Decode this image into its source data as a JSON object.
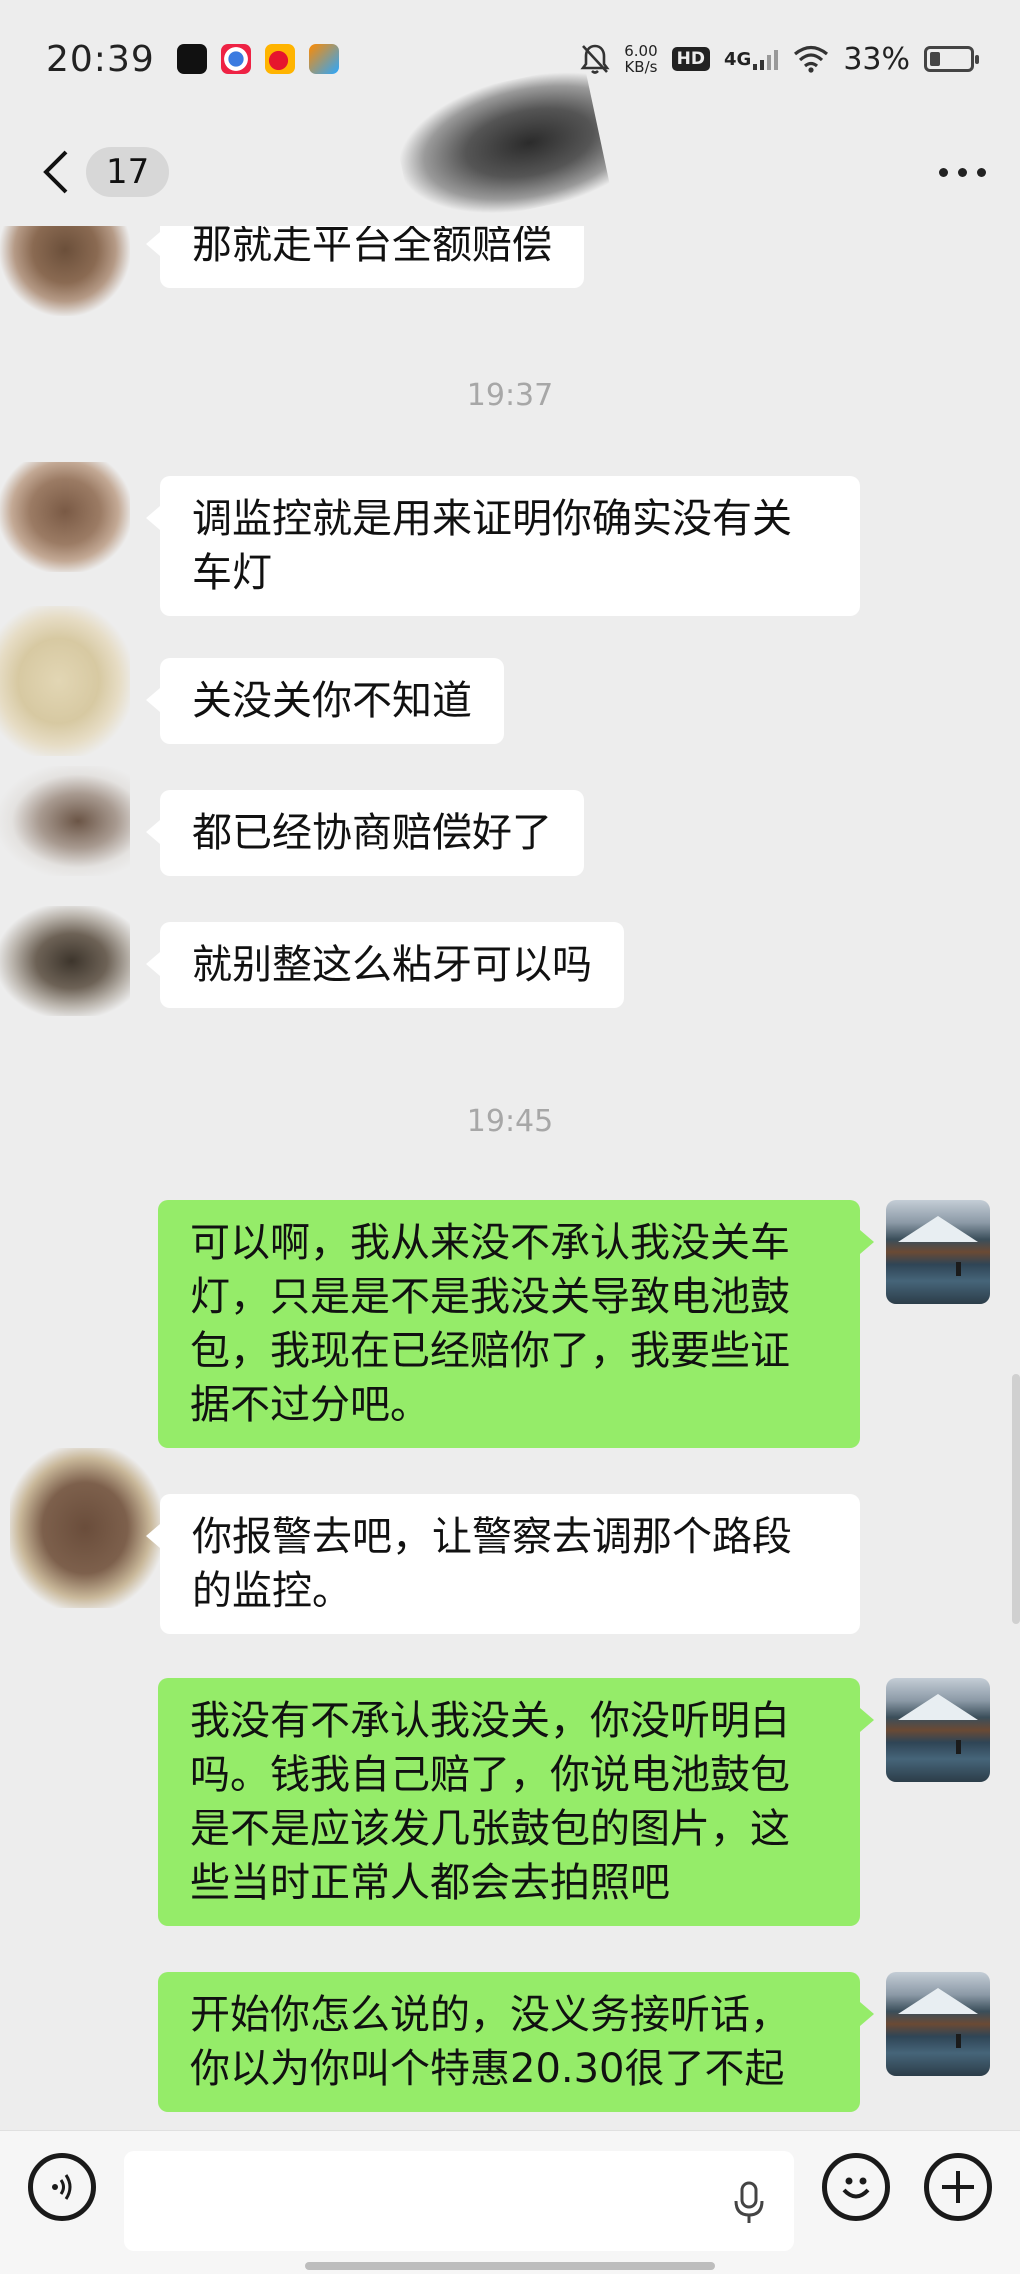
{
  "status_bar": {
    "time": "20:39",
    "speed_value": "6.00",
    "speed_unit": "KB/s",
    "hd_label": "HD",
    "network": "4G",
    "battery": "33%"
  },
  "header": {
    "unread_count": "17"
  },
  "messages": [
    {
      "type": "in",
      "text": "那就走平台全额赔偿"
    },
    {
      "type": "time",
      "text": "19:37"
    },
    {
      "type": "in",
      "lines": [
        "调监控就是用来证明你确实没有关",
        "车灯"
      ]
    },
    {
      "type": "in",
      "text": "关没关你不知道"
    },
    {
      "type": "in",
      "text": "都已经协商赔偿好了"
    },
    {
      "type": "in",
      "text": "就别整这么粘牙可以吗"
    },
    {
      "type": "time",
      "text": "19:45"
    },
    {
      "type": "out",
      "lines": [
        "可以啊，我从来没不承认我没关车",
        "灯，只是是不是我没关导致电池鼓",
        "包，我现在已经赔你了，我要些证",
        "据不过分吧。"
      ]
    },
    {
      "type": "in",
      "lines": [
        "你报警去吧，让警察去调那个路段",
        "的监控。"
      ]
    },
    {
      "type": "out",
      "lines": [
        "我没有不承认我没关，你没听明白",
        "吗。钱我自己赔了，你说电池鼓包",
        "是不是应该发几张鼓包的图片，这",
        "些当时正常人都会去拍照吧"
      ]
    },
    {
      "type": "out",
      "lines": [
        "开始你怎么说的，没义务接听话，",
        "你以为你叫个特惠20.30很了不起"
      ]
    }
  ],
  "colors": {
    "background": "#ededed",
    "incoming_bubble": "#ffffff",
    "outgoing_bubble": "#95ec69"
  },
  "icons": [
    "back-arrow",
    "more-dots",
    "voice-toggle",
    "microphone",
    "emoji",
    "add"
  ]
}
